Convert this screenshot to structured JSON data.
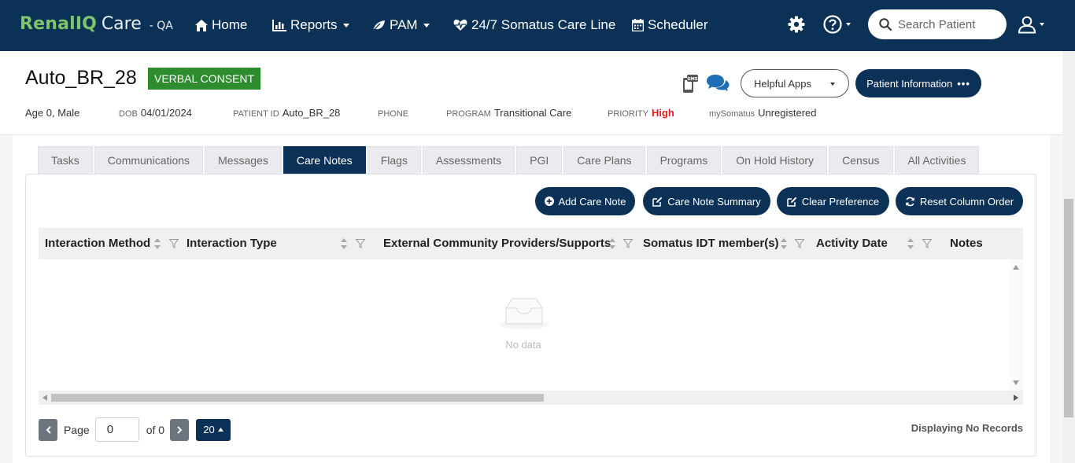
{
  "nav": {
    "brand_renal": "Renal",
    "brand_iq": "IQ",
    "brand_care": "Care",
    "brand_env": "- QA",
    "home": "Home",
    "reports": "Reports",
    "pam": "PAM",
    "care_line": "24/7 Somatus Care Line",
    "scheduler": "Scheduler",
    "search_placeholder": "Search Patient"
  },
  "patient": {
    "name": "Auto_BR_28",
    "consent": "VERBAL CONSENT",
    "age_sex": "Age 0, Male",
    "dob_label": "DOB",
    "dob": "04/01/2024",
    "id_label": "PATIENT ID",
    "id": "Auto_BR_28",
    "phone_label": "PHONE",
    "phone": "",
    "program_label": "PROGRAM",
    "program": "Transitional Care",
    "priority_label": "PRIORITY",
    "priority": "High",
    "mysomatus_label": "mySomatus",
    "mysomatus": "Unregistered",
    "helpful_apps": "Helpful Apps",
    "patient_info": "Patient Information",
    "sms_label": "SMS"
  },
  "tabs": [
    "Tasks",
    "Communications",
    "Messages",
    "Care Notes",
    "Flags",
    "Assessments",
    "PGI",
    "Care Plans",
    "Programs",
    "On Hold History",
    "Census",
    "All Activities"
  ],
  "active_tab": "Care Notes",
  "actions": {
    "add": "Add Care Note",
    "summary": "Care Note Summary",
    "clear": "Clear Preference",
    "reset": "Reset Column Order"
  },
  "table": {
    "columns": [
      "Interaction Method",
      "Interaction Type",
      "External Community Providers/Supports",
      "Somatus IDT member(s)",
      "Activity Date",
      "Notes"
    ],
    "empty_text": "No data"
  },
  "pager": {
    "page_label": "Page",
    "page_value": "0",
    "of_label": "of 0",
    "page_size": "20",
    "status": "Displaying No Records"
  },
  "colors": {
    "navy": "#0b3256",
    "green": "#7fc56b",
    "consent": "#2e8b2e",
    "priority_high": "#e02020"
  }
}
